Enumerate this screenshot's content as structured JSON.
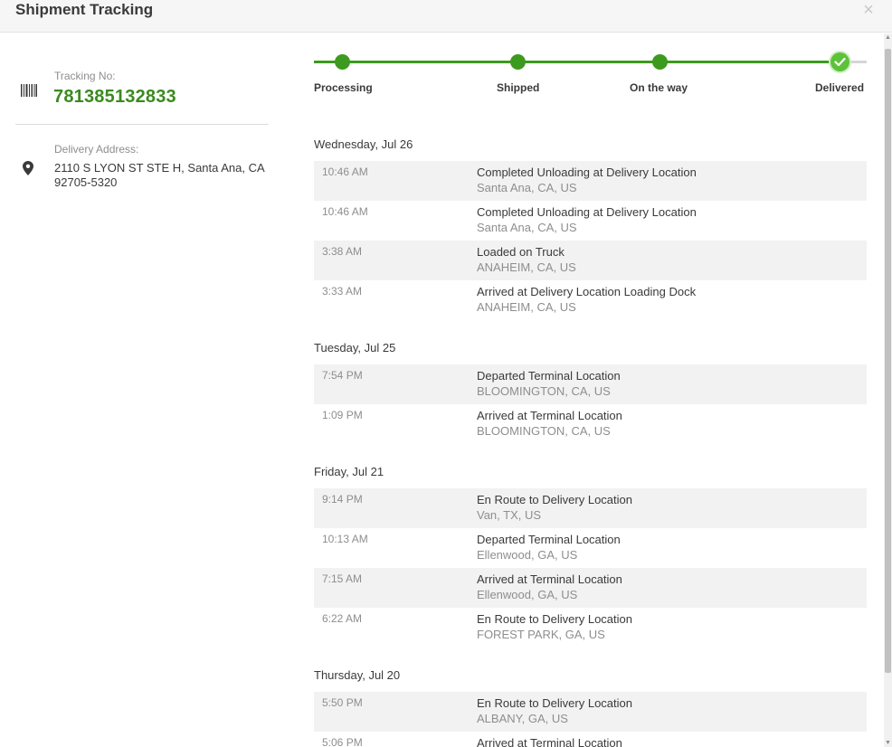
{
  "header": {
    "title": "Shipment Tracking",
    "close_glyph": "×"
  },
  "tracking": {
    "label": "Tracking No:",
    "number": "781385132833",
    "icon": "barcode-icon",
    "accent_color": "#3a8a1e"
  },
  "address": {
    "label": "Delivery Address:",
    "text": "2110 S LYON ST STE H, Santa Ana, CA 92705-5320",
    "icon": "map-pin-icon"
  },
  "progress": {
    "color_done": "#3d9a1f",
    "color_current": "#5cc23a",
    "steps": [
      {
        "label": "Processing"
      },
      {
        "label": "Shipped"
      },
      {
        "label": "On the way"
      },
      {
        "label": "Delivered"
      }
    ]
  },
  "days": [
    {
      "date": "Wednesday, Jul 26",
      "events": [
        {
          "time": "10:46 AM",
          "desc": "Completed Unloading at Delivery Location",
          "loc": "Santa Ana, CA, US"
        },
        {
          "time": "10:46 AM",
          "desc": "Completed Unloading at Delivery Location",
          "loc": "Santa Ana, CA, US"
        },
        {
          "time": "3:38 AM",
          "desc": "Loaded on Truck",
          "loc": "ANAHEIM, CA, US"
        },
        {
          "time": "3:33 AM",
          "desc": "Arrived at Delivery Location Loading Dock",
          "loc": "ANAHEIM, CA, US"
        }
      ]
    },
    {
      "date": "Tuesday, Jul 25",
      "events": [
        {
          "time": "7:54 PM",
          "desc": "Departed Terminal Location",
          "loc": "BLOOMINGTON, CA, US"
        },
        {
          "time": "1:09 PM",
          "desc": "Arrived at Terminal Location",
          "loc": "BLOOMINGTON, CA, US"
        }
      ]
    },
    {
      "date": "Friday, Jul 21",
      "events": [
        {
          "time": "9:14 PM",
          "desc": "En Route to Delivery Location",
          "loc": "Van, TX, US"
        },
        {
          "time": "10:13 AM",
          "desc": "Departed Terminal Location",
          "loc": "Ellenwood, GA, US"
        },
        {
          "time": "7:15 AM",
          "desc": "Arrived at Terminal Location",
          "loc": "Ellenwood, GA, US"
        },
        {
          "time": "6:22 AM",
          "desc": "En Route to Delivery Location",
          "loc": "FOREST PARK, GA, US"
        }
      ]
    },
    {
      "date": "Thursday, Jul 20",
      "events": [
        {
          "time": "5:50 PM",
          "desc": "En Route to Delivery Location",
          "loc": "ALBANY, GA, US"
        },
        {
          "time": "5:06 PM",
          "desc": "Arrived at Terminal Location",
          "loc": ""
        }
      ]
    }
  ]
}
